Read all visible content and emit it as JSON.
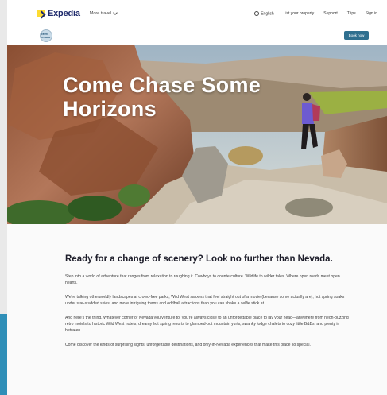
{
  "header": {
    "brand": "Expedia",
    "more_travel": "More travel",
    "links": {
      "language": "English",
      "list_property": "List your property",
      "support": "Support",
      "trips": "Trips",
      "sign_in": "Sign in"
    }
  },
  "subheader": {
    "badge_text": "travel nevada",
    "book_button": "Book now"
  },
  "hero": {
    "title": "Come Chase Some Horizons"
  },
  "article": {
    "heading": "Ready for a change of scenery? Look no further than Nevada.",
    "paragraphs": [
      "Step into a world of adventure that ranges from relaxation to roughing it. Cowboys to counterculture. Wildlife to wilder tales. Where open roads meet open hearts.",
      "We're talking otherworldly landscapes at crowd-free parks, Wild West saloons that feel straight out of a movie (because some actually are), hot spring soaks under star-studded skies, and more intriguing towns and oddball attractions than you can shake a selfie stick at.",
      "And here's the thing. Whatever corner of Nevada you venture to, you're always close to an unforgettable place to lay your head—anywhere from neon-buzzing retro motels to historic Wild West hotels, dreamy hot spring resorts to glamped-out mountain yurts, swanky lodge chalets to cozy little B&Bs, and plenty in between.",
      "Come discover the kinds of surprising sights, unforgettable destinations, and only-in-Nevada experiences that make this place so special."
    ]
  },
  "colors": {
    "brand_navy": "#1f2b6c",
    "brand_yellow": "#fddb32",
    "button_teal": "#2f6f8f",
    "edge_accent": "#2f8fb8"
  }
}
